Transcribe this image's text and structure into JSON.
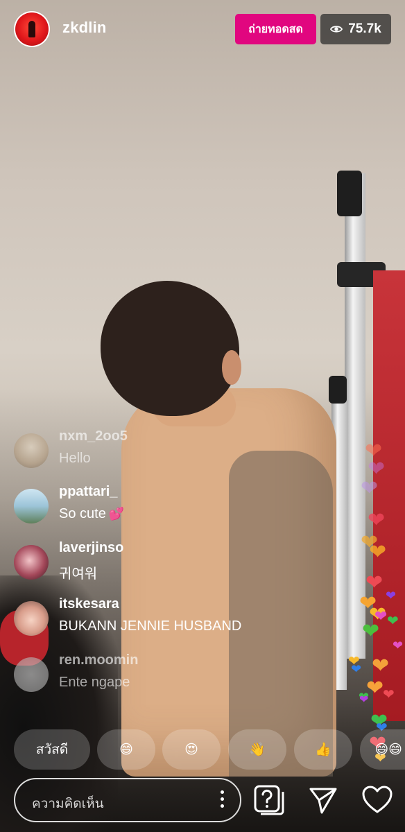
{
  "header": {
    "username": "zkdlin",
    "live_label": "ถ่ายทอดสด",
    "viewer_count": "75.7k",
    "eye_icon": "eye-icon"
  },
  "comments": [
    {
      "user": "nxm_2oo5",
      "text": "Hello",
      "faded": true
    },
    {
      "user": "ppattari_",
      "text": "So cute",
      "emoji": "💕",
      "faded": false
    },
    {
      "user": "laverjinso",
      "text": "귀여워",
      "faded": false
    },
    {
      "user": "itskesara",
      "text": "BUKANN JENNIE HUSBAND",
      "faded": false
    },
    {
      "user": "ren.moomin",
      "text": "Ente ngape",
      "faded": true
    }
  ],
  "quick_reactions": [
    {
      "label": "สวัสดี",
      "kind": "text"
    },
    {
      "label": "😄",
      "kind": "emoji",
      "icon": "grinning-face-icon"
    },
    {
      "label": "😍",
      "kind": "emoji",
      "icon": "heart-eyes-icon"
    },
    {
      "label": "👋",
      "kind": "emoji",
      "icon": "waving-hand-icon"
    },
    {
      "label": "👍",
      "kind": "emoji",
      "icon": "thumbs-up-icon"
    },
    {
      "label": "😄😄",
      "kind": "emoji",
      "icon": "grinning-face-icon"
    }
  ],
  "bottom_bar": {
    "comment_placeholder": "ความคิดเห็น",
    "more_icon": "more-options-icon",
    "question_icon": "question-icon",
    "send_icon": "send-icon",
    "like_icon": "heart-icon"
  },
  "colors": {
    "live_badge": "#e1067f",
    "viewer_badge_bg": "#282828"
  }
}
